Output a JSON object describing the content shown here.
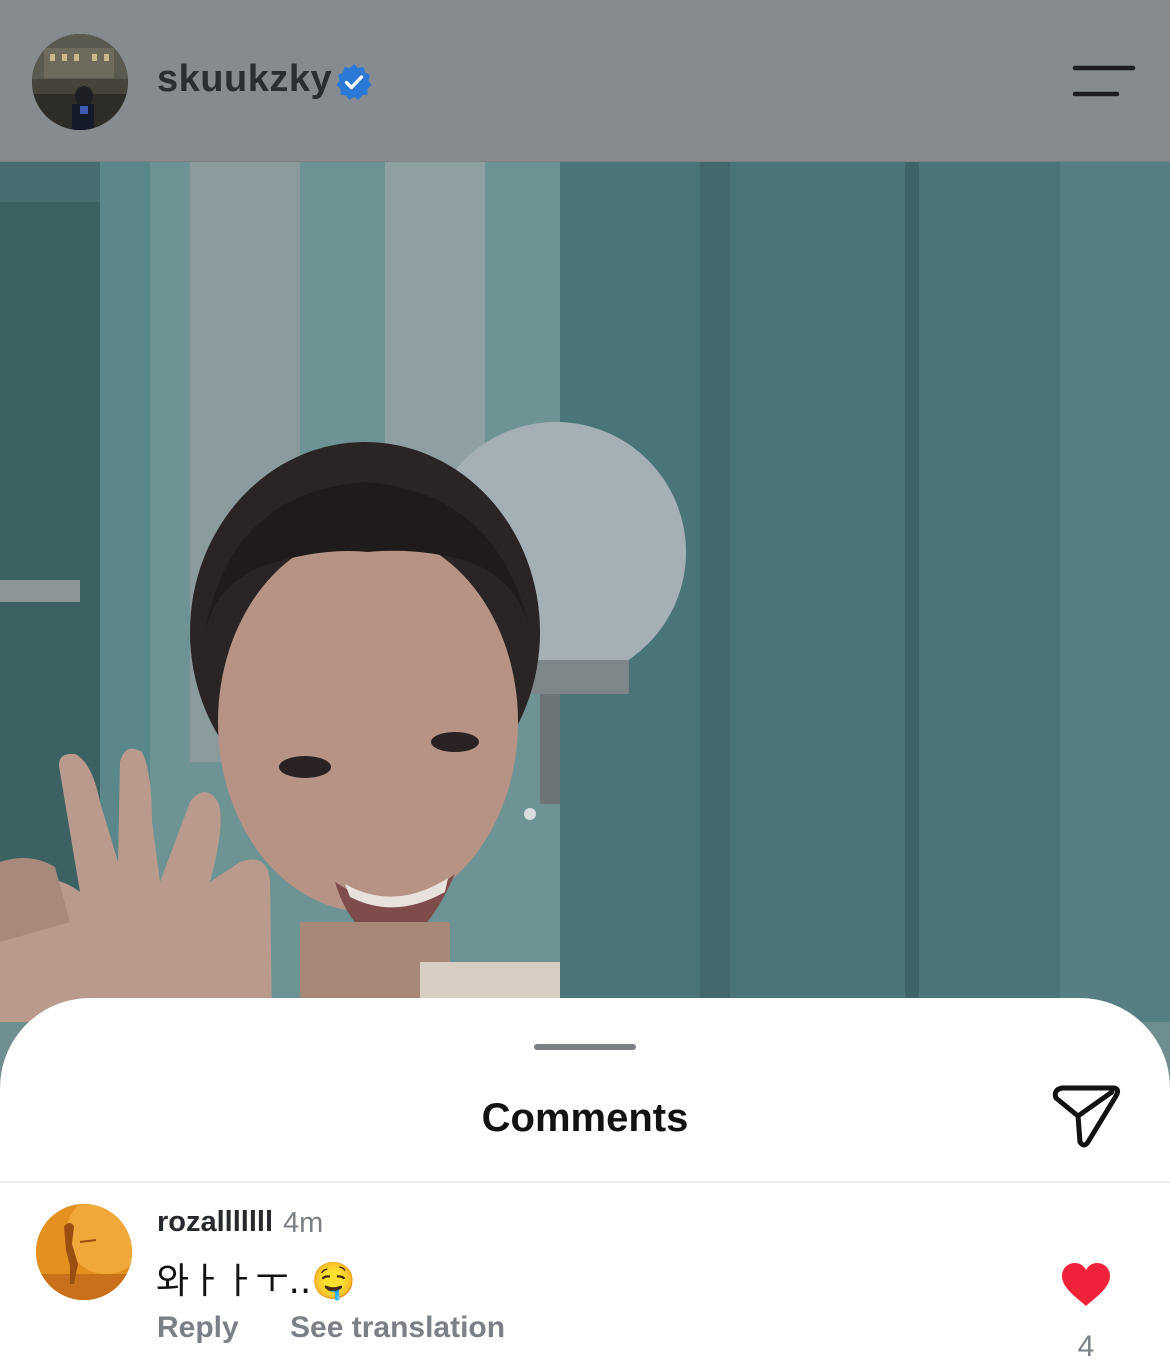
{
  "post": {
    "username": "skuukzky",
    "verified": true,
    "verified_icon": "verified-badge-icon",
    "menu_icon": "hamburger-menu-icon",
    "accent_color": "#2b78d6"
  },
  "comments_sheet": {
    "title": "Comments",
    "share_icon": "send-paper-plane-icon",
    "comments": [
      {
        "username": "rozalllllll",
        "time": "4m",
        "text": "와ㅏㅏㅜ..🤤",
        "reply_label": "Reply",
        "translate_label": "See translation",
        "liked": true,
        "like_count": "4",
        "like_color": "#f0233b"
      }
    ]
  }
}
